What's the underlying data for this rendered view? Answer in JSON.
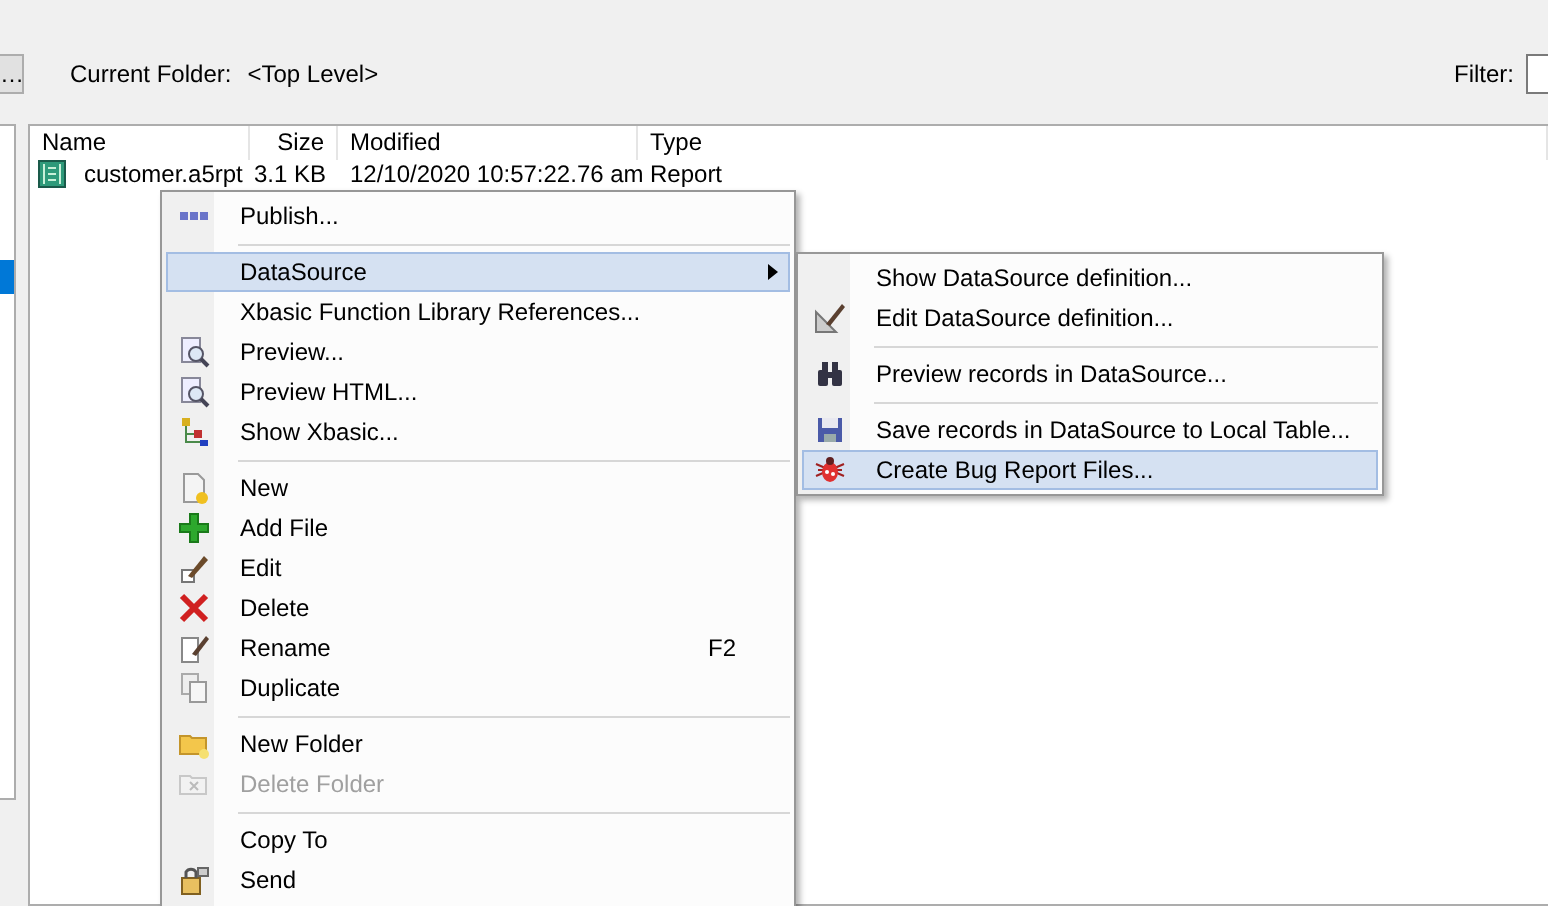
{
  "toolbar": {
    "browse_button": "…",
    "current_folder_label": "Current Folder:",
    "current_folder": "<Top Level>",
    "filter_label": "Filter:"
  },
  "sidebar": {
    "items": [
      {
        "selected": true
      }
    ]
  },
  "file_list": {
    "columns": [
      "Name",
      "Size",
      "Modified",
      "Type"
    ],
    "rows": [
      {
        "name": "customer.a5rpt",
        "size": "3.1 KB",
        "modified": "12/10/2020 10:57:22.76 am",
        "type": "Report"
      }
    ]
  },
  "context_menu": {
    "items": [
      {
        "kind": "item",
        "label": "Publish...",
        "selected": false,
        "disabled": false
      },
      {
        "kind": "separator"
      },
      {
        "kind": "item",
        "label": "DataSource",
        "selected": true,
        "disabled": false,
        "has_submenu": true
      },
      {
        "kind": "item",
        "label": "Xbasic Function Library References...",
        "selected": false,
        "disabled": false
      },
      {
        "kind": "item",
        "label": "Preview...",
        "selected": false,
        "disabled": false
      },
      {
        "kind": "item",
        "label": "Preview HTML...",
        "selected": false,
        "disabled": false
      },
      {
        "kind": "item",
        "label": "Show Xbasic...",
        "selected": false,
        "disabled": false
      },
      {
        "kind": "separator"
      },
      {
        "kind": "item",
        "label": "New",
        "selected": false,
        "disabled": false
      },
      {
        "kind": "item",
        "label": "Add File",
        "selected": false,
        "disabled": false
      },
      {
        "kind": "item",
        "label": "Edit",
        "selected": false,
        "disabled": false
      },
      {
        "kind": "item",
        "label": "Delete",
        "selected": false,
        "disabled": false
      },
      {
        "kind": "item",
        "label": "Rename",
        "shortcut": "F2",
        "selected": false,
        "disabled": false
      },
      {
        "kind": "item",
        "label": "Duplicate",
        "selected": false,
        "disabled": false
      },
      {
        "kind": "separator"
      },
      {
        "kind": "item",
        "label": "New Folder",
        "selected": false,
        "disabled": false
      },
      {
        "kind": "item",
        "label": "Delete Folder",
        "selected": false,
        "disabled": true
      },
      {
        "kind": "separator"
      },
      {
        "kind": "item",
        "label": "Copy To",
        "selected": false,
        "disabled": false
      },
      {
        "kind": "item",
        "label": "Send",
        "selected": false,
        "disabled": false
      }
    ]
  },
  "submenu": {
    "items": [
      {
        "kind": "item",
        "label": "Show DataSource definition...",
        "selected": false,
        "disabled": false
      },
      {
        "kind": "item",
        "label": "Edit DataSource definition...",
        "selected": false,
        "disabled": false
      },
      {
        "kind": "separator"
      },
      {
        "kind": "item",
        "label": "Preview records in DataSource...",
        "selected": false,
        "disabled": false
      },
      {
        "kind": "separator"
      },
      {
        "kind": "item",
        "label": "Save records in DataSource to Local Table...",
        "selected": false,
        "disabled": false
      },
      {
        "kind": "item",
        "label": "Create Bug Report Files...",
        "selected": true,
        "disabled": false
      }
    ]
  }
}
